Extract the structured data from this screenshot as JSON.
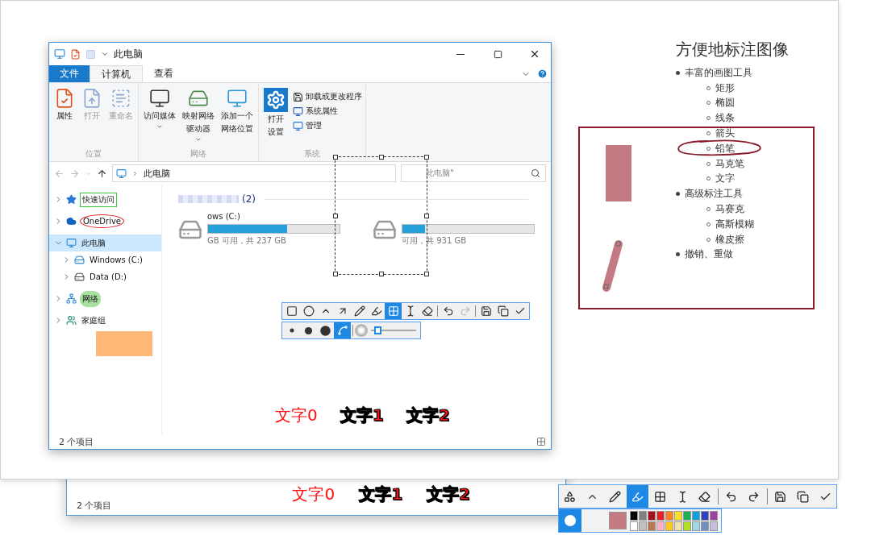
{
  "back_window": {
    "status": "2 个项目",
    "texts": [
      {
        "text": "文字0",
        "kind": "plain"
      },
      {
        "text": "文字1",
        "kind": "outlined"
      },
      {
        "text": "文字2",
        "kind": "outlined"
      }
    ]
  },
  "explorer": {
    "title": "此电脑",
    "ribbon_tabs": [
      {
        "label": "文件",
        "kind": "file",
        "selected": false
      },
      {
        "label": "计算机",
        "kind": "tab",
        "selected": true
      },
      {
        "label": "查看",
        "kind": "tab",
        "selected": false
      }
    ],
    "ribbon_groups": [
      {
        "label": "位置",
        "items": [
          {
            "kind": "properties",
            "lines": [
              "属性"
            ],
            "disabled": false,
            "dropdown": false
          },
          {
            "kind": "open",
            "lines": [
              "打开"
            ],
            "disabled": true,
            "dropdown": false
          },
          {
            "kind": "rename",
            "lines": [
              "重命名"
            ],
            "disabled": true,
            "dropdown": false
          }
        ]
      },
      {
        "label": "网络",
        "items": [
          {
            "kind": "media",
            "lines": [
              "访问媒体"
            ],
            "disabled": false,
            "dropdown": true
          },
          {
            "kind": "map-drive",
            "lines": [
              "映射网络",
              "驱动器"
            ],
            "disabled": false,
            "dropdown": true
          },
          {
            "kind": "add-location",
            "lines": [
              "添加一个",
              "网络位置"
            ],
            "disabled": false,
            "dropdown": false
          }
        ]
      },
      {
        "label": "系统",
        "items": [
          {
            "kind": "settings",
            "lines": [
              "打开",
              "设置"
            ],
            "disabled": false,
            "dropdown": false
          }
        ],
        "small_items": [
          {
            "kind": "uninstall",
            "label": "卸载或更改程序"
          },
          {
            "kind": "sysprops",
            "label": "系统属性"
          },
          {
            "kind": "manage",
            "label": "管理"
          }
        ]
      }
    ],
    "address": {
      "path": "此电脑",
      "search_placeholder": "此电脑\""
    },
    "tree": [
      {
        "label": "快速访问",
        "kind": "quick",
        "expanded": false,
        "selected": false,
        "annotation": {
          "kind": "rect",
          "color": "#3cc83c"
        }
      },
      {
        "label": "OneDrive",
        "kind": "cloud",
        "expanded": false,
        "selected": false,
        "annotation": {
          "kind": "ellipse",
          "color": "#e02020"
        }
      },
      {
        "label": "此电脑",
        "kind": "pc",
        "expanded": true,
        "selected": true,
        "children": [
          {
            "label": "Windows (C:)",
            "kind": "sysdrive",
            "expanded": false,
            "selected": false
          },
          {
            "label": "Data (D:)",
            "kind": "drive",
            "expanded": false,
            "selected": false
          }
        ]
      },
      {
        "label": "网络",
        "kind": "network",
        "expanded": false,
        "selected": false,
        "annotation": {
          "kind": "marker",
          "color": "#a8e0a0"
        }
      },
      {
        "label": "家庭组",
        "kind": "homegroup",
        "expanded": false,
        "selected": false
      }
    ],
    "group_count": "(2)",
    "drives": [
      {
        "name": "ows (C:)",
        "level": 0.6,
        "free": "GB 可用，共 237 GB"
      },
      {
        "level": 0.17,
        "free": "可用，共 931 GB"
      }
    ],
    "status": "2 个项目",
    "toolbar": {
      "tools": [
        {
          "kind": "rect",
          "selected": false
        },
        {
          "kind": "ellipse",
          "selected": false
        },
        {
          "kind": "line",
          "selected": false
        },
        {
          "kind": "arrow",
          "selected": false
        },
        {
          "kind": "pencil",
          "selected": false
        },
        {
          "kind": "marker",
          "selected": false
        },
        {
          "kind": "mosaic",
          "selected": true
        },
        {
          "kind": "text",
          "selected": false
        },
        {
          "kind": "eraser",
          "selected": false
        },
        {
          "kind": "undo",
          "selected": false
        },
        {
          "kind": "redo",
          "selected": false,
          "disabled": true
        },
        {
          "kind": "save",
          "selected": false
        },
        {
          "kind": "copy",
          "selected": false
        },
        {
          "kind": "done",
          "selected": false
        }
      ],
      "sizes": [
        {
          "kind": "small",
          "selected": false
        },
        {
          "kind": "medium",
          "selected": false
        },
        {
          "kind": "large",
          "selected": false
        },
        {
          "kind": "hatch",
          "selected": true
        }
      ],
      "level": 0.15
    },
    "texts": [
      {
        "text": "文字0",
        "kind": "plain"
      },
      {
        "text": "文字1",
        "kind": "outlined"
      },
      {
        "text": "文字2",
        "kind": "outlined"
      }
    ]
  },
  "features": {
    "title": "方便地标注图像",
    "items": [
      {
        "label": "丰富的画图工具",
        "children": [
          {
            "label": "矩形"
          },
          {
            "label": "椭圆"
          },
          {
            "label": "线条"
          },
          {
            "label": "箭头"
          },
          {
            "label": "铅笔"
          },
          {
            "label": "马克笔"
          },
          {
            "label": "文字"
          }
        ]
      },
      {
        "label": "高级标注工具",
        "children": [
          {
            "label": "马赛克"
          },
          {
            "label": "高斯模糊"
          },
          {
            "label": "橡皮擦"
          }
        ]
      },
      {
        "label": "撤销、重做"
      }
    ]
  },
  "bottom_toolbar": {
    "tools": [
      {
        "kind": "shapes",
        "selected": false
      },
      {
        "kind": "line",
        "selected": false
      },
      {
        "kind": "pencil",
        "selected": false
      },
      {
        "kind": "marker",
        "selected": true
      },
      {
        "kind": "mosaic",
        "selected": false
      },
      {
        "kind": "text",
        "selected": false
      },
      {
        "kind": "eraser",
        "selected": false
      },
      {
        "kind": "undo",
        "selected": false
      },
      {
        "kind": "redo",
        "selected": false
      },
      {
        "kind": "save",
        "selected": false
      },
      {
        "kind": "copy",
        "selected": false
      },
      {
        "kind": "done",
        "selected": false
      }
    ],
    "palette": [
      {
        "color": "#000000"
      },
      {
        "color": "#808080"
      },
      {
        "color": "#a01020"
      },
      {
        "color": "#e82020"
      },
      {
        "color": "#ff8020"
      },
      {
        "color": "#ffe020"
      },
      {
        "color": "#20b050"
      },
      {
        "color": "#10a0e0"
      },
      {
        "color": "#3040c0"
      },
      {
        "color": "#a040a0"
      },
      {
        "color": "#ffffff"
      },
      {
        "color": "#c0c0c0"
      },
      {
        "color": "#b87850"
      },
      {
        "color": "#ffb0c8"
      },
      {
        "color": "#ffc820"
      },
      {
        "color": "#f0e0b0"
      },
      {
        "color": "#b0e020"
      },
      {
        "color": "#a0d8e8"
      },
      {
        "color": "#7090c0"
      },
      {
        "color": "#c8c0e0"
      }
    ]
  }
}
